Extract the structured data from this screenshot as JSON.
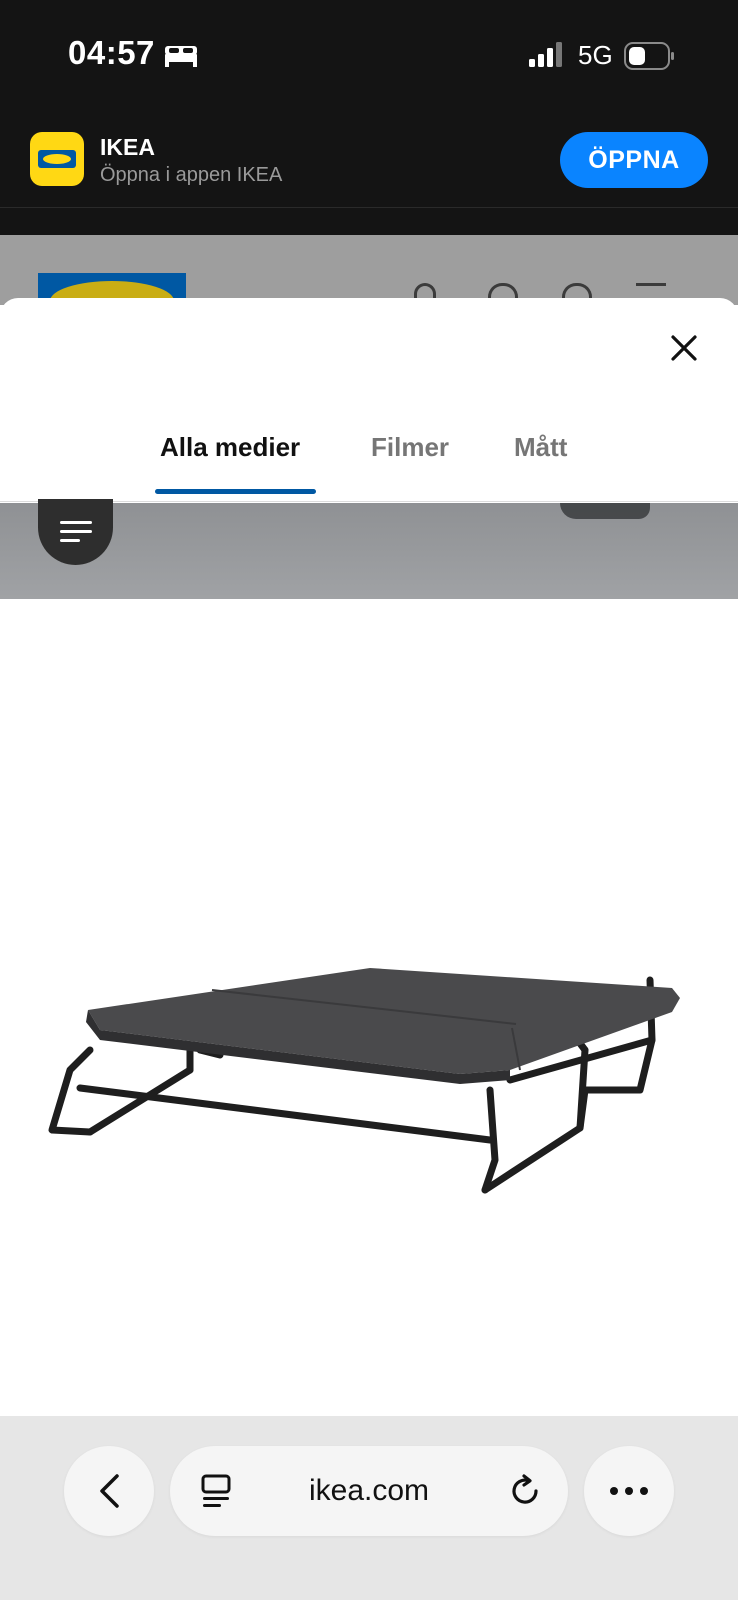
{
  "status_bar": {
    "time": "04:57",
    "network": "5G",
    "icons": [
      "bed-icon",
      "signal-icon",
      "battery-icon"
    ]
  },
  "app_banner": {
    "app_name": "IKEA",
    "subtitle": "Öppna i appen IKEA",
    "open_label": "ÖPPNA",
    "accent_color": "#0a84ff"
  },
  "media_sheet": {
    "tabs": [
      {
        "label": "Alla medier",
        "active": true
      },
      {
        "label": "Filmer",
        "active": false
      },
      {
        "label": "Mått",
        "active": false
      }
    ],
    "close_icon": "close-icon",
    "filter_icon": "filter-lines-icon",
    "image_subject": "folding-bed-product-icon",
    "tab_indicator_color": "#0058a3"
  },
  "browser_toolbar": {
    "url": "ikea.com",
    "icons": [
      "chevron-left-icon",
      "reader-icon",
      "reload-icon",
      "more-icon"
    ]
  }
}
